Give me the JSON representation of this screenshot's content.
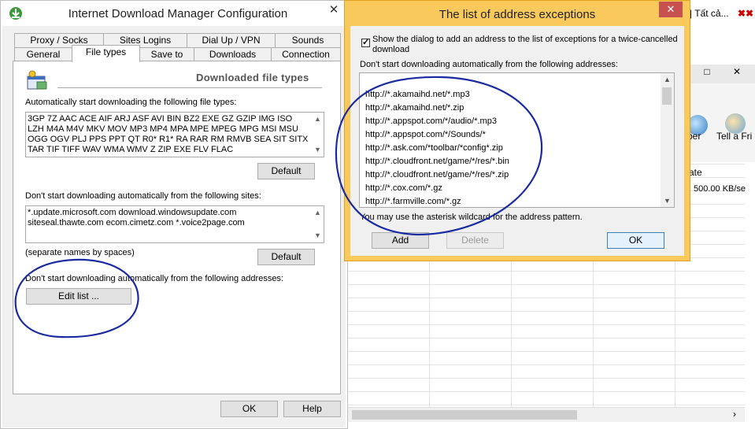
{
  "background_window": {
    "browser_tab_text": "| Tất cả...",
    "toolbar_labels": [
      "ber",
      "Tell a Fri"
    ],
    "column_header": "rate",
    "cell_value": "500.00  KB/se",
    "min_glyph": "□",
    "close_glyph": "✕",
    "scroll_right_glyph": "›"
  },
  "config_dialog": {
    "title": "Internet Download Manager Configuration",
    "close_glyph": "✕",
    "tabs_row1": [
      "Proxy / Socks",
      "Sites Logins",
      "Dial Up / VPN",
      "Sounds"
    ],
    "tabs_row2": [
      "General",
      "File types",
      "Save to",
      "Downloads",
      "Connection"
    ],
    "active_tab": "File types",
    "section_header": "Downloaded file types",
    "file_types_label": "Automatically start downloading the following file types:",
    "file_types_value": "3GP 7Z AAC ACE AIF ARJ ASF AVI BIN BZ2 EXE GZ GZIP IMG ISO LZH M4A M4V MKV MOV MP3 MP4 MPA MPE MPEG MPG MSI MSU OGG OGV PLJ PPS PPT QT R0* R1* RA RAR RM RMVB SEA SIT SITX TAR TIF TIFF WAV WMA WMV Z ZIP EXE FLV FLAC",
    "default_button_1": "Default",
    "sites_label": "Don't start downloading automatically from the following sites:",
    "sites_value": "*.update.microsoft.com download.windowsupdate.com siteseal.thawte.com ecom.cimetz.com *.voice2page.com",
    "separate_note": "(separate names by spaces)",
    "default_button_2": "Default",
    "addresses_label": "Don't start downloading automatically from the following addresses:",
    "edit_list_button": "Edit list ...",
    "ok_button": "OK",
    "help_button": "Help"
  },
  "exceptions_dialog": {
    "title": "The list of address exceptions",
    "close_glyph": "✕",
    "checkbox_checked": true,
    "checkbox_label_line1": "Show the dialog to add an address to the list of exceptions for a twice-cancelled",
    "checkbox_label_line2": "download",
    "list_label": "Don't start downloading automatically from the following addresses:",
    "addresses": [
      "http://*.akamaihd.net/*.mp3",
      "http://*.akamaihd.net/*.zip",
      "http://*.appspot.com/*/audio/*.mp3",
      "http://*.appspot.com/*/Sounds/*",
      "http://*.ask.com/*toolbar/*config*.zip",
      "http://*.cloudfront.net/game/*/res/*.bin",
      "http://*.cloudfront.net/game/*/res/*.zip",
      "http://*.cox.com/*.gz",
      "http://*.farmville.com/*.gz"
    ],
    "wildcard_note": "You may use the asterisk wildcard for the address pattern.",
    "add_button": "Add",
    "delete_button": "Delete",
    "ok_button": "OK"
  },
  "colors": {
    "exceptions_frame": "#f9c95c",
    "close_red": "#c75050",
    "annotation_ink": "#1a2aa0"
  }
}
